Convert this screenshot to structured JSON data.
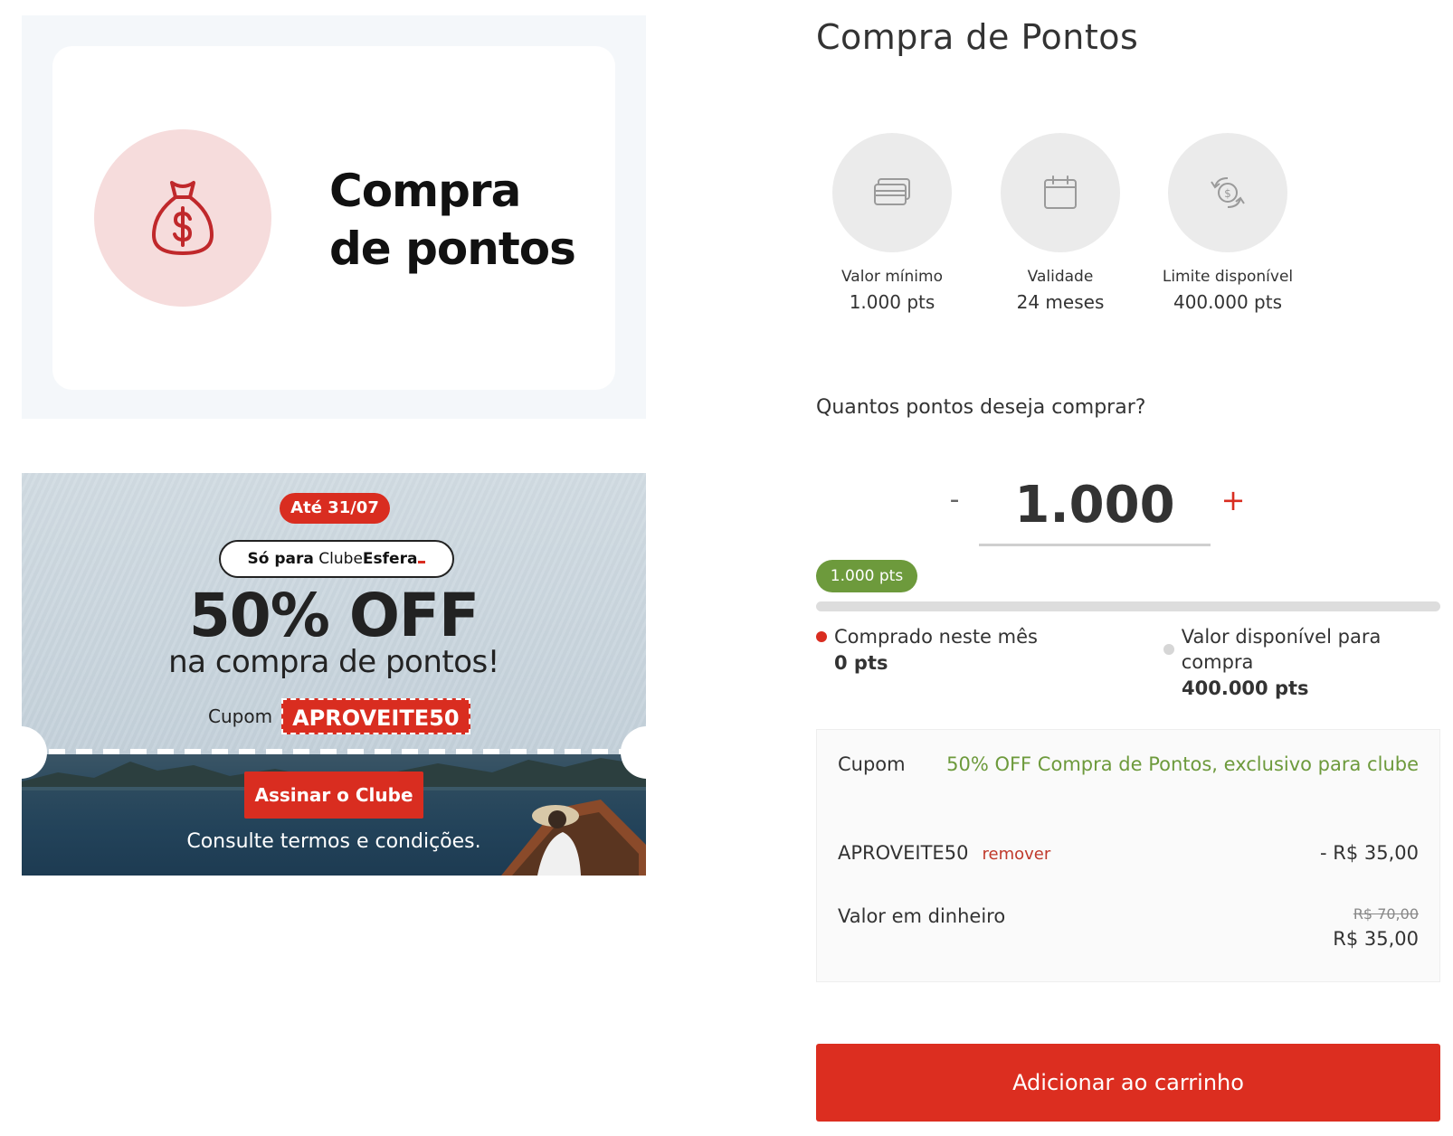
{
  "hero": {
    "title_line1": "Compra",
    "title_line2": "de pontos",
    "icon": "money-bag-icon",
    "accent": "#c0282b",
    "circle_color": "#f6dcdc"
  },
  "promo": {
    "date_badge": "Até 31/07",
    "club_prefix": "Só para",
    "club_name_light": "Clube",
    "club_name_bold": "Esfera",
    "headline": "50% OFF",
    "subheadline": "na compra de pontos!",
    "coupon_label": "Cupom",
    "coupon_code": "APROVEITE50",
    "cta_label": "Assinar o Clube",
    "terms": "Consulte termos e condições."
  },
  "page": {
    "title": "Compra de Pontos"
  },
  "info": [
    {
      "icon": "cards-icon",
      "label": "Valor mínimo",
      "value": "1.000 pts"
    },
    {
      "icon": "calendar-icon",
      "label": "Validade",
      "value": "24 meses"
    },
    {
      "icon": "exchange-money-icon",
      "label": "Limite disponível",
      "value": "400.000 pts"
    }
  ],
  "purchase": {
    "question": "Quantos pontos deseja comprar?",
    "minus_label": "-",
    "plus_label": "+",
    "quantity": "1.000",
    "selected_pill": "1.000 pts",
    "progress_fraction": 0,
    "purchased_label": "Comprado neste mês",
    "purchased_value": "0 pts",
    "available_label": "Valor disponível para compra",
    "available_value": "400.000 pts",
    "purchased_color": "#d92d20",
    "available_color": "#d6d6d6"
  },
  "summary": {
    "coupon_label": "Cupom",
    "coupon_description": "50% OFF Compra de Pontos, exclusivo para clube",
    "coupon_code": "APROVEITE50",
    "remove_label": "remover",
    "discount_value": "- R$ 35,00",
    "cash_label": "Valor em dinheiro",
    "old_price": "R$ 70,00",
    "new_price": "R$ 35,00"
  },
  "cart": {
    "button_label": "Adicionar ao carrinho",
    "color": "#dc2e20"
  }
}
